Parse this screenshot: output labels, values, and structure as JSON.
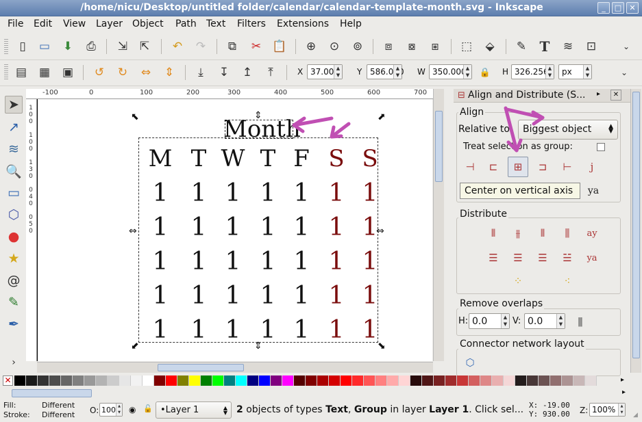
{
  "window": {
    "title": "/home/nicu/Desktop/untitled folder/calendar/calendar-template-month.svg - Inkscape",
    "buttons": [
      "_",
      "□",
      "✕"
    ]
  },
  "menu": [
    "File",
    "Edit",
    "View",
    "Layer",
    "Object",
    "Path",
    "Text",
    "Filters",
    "Extensions",
    "Help"
  ],
  "controls": {
    "x_label": "X",
    "x_value": "37.000",
    "y_label": "Y",
    "y_value": "586.000",
    "w_label": "W",
    "w_value": "350.000",
    "h_label": "H",
    "h_value": "326.256",
    "unit": "px"
  },
  "ruler": {
    "labels": [
      "-100",
      "0",
      "100",
      "200",
      "300",
      "400",
      "500",
      "600",
      "700"
    ],
    "vlabels": [
      "1",
      "0",
      "0",
      "1",
      "0",
      "0",
      "1",
      "3",
      "0",
      "0",
      "4",
      "0",
      "0",
      "5",
      "0",
      "0",
      "6",
      "0",
      "0",
      "7",
      "0",
      "0",
      "8",
      "0",
      "0"
    ]
  },
  "calendar": {
    "title": "Month",
    "weekdays": [
      "M",
      "T",
      "W",
      "T",
      "F",
      "S",
      "S"
    ],
    "cell": "1",
    "rows": 5,
    "weekend_color": "#7a0d0d"
  },
  "dock": {
    "title": "Align and Distribute (S...",
    "align_header": "Align",
    "relative_label": "Relative to:",
    "relative_value": "Biggest object",
    "treat_label": "Treat selection as group:",
    "tooltip": "Center on vertical axis",
    "distribute_header": "Distribute",
    "overlaps_header": "Remove overlaps",
    "h_label": "H:",
    "h_value": "0.0",
    "v_label": "V:",
    "v_value": "0.0",
    "connector_header": "Connector network layout"
  },
  "palette": [
    "#000000",
    "#1a1a1a",
    "#333333",
    "#4d4d4d",
    "#666666",
    "#808080",
    "#999999",
    "#b3b3b3",
    "#cccccc",
    "#e6e6e6",
    "#f2f2f2",
    "#ffffff",
    "#800000",
    "#ff0000",
    "#808000",
    "#ffff00",
    "#008000",
    "#00ff00",
    "#008080",
    "#00ffff",
    "#000080",
    "#0000ff",
    "#800080",
    "#ff00ff",
    "#550000",
    "#800000",
    "#aa0000",
    "#d40000",
    "#ff0000",
    "#ff2a2a",
    "#ff5555",
    "#ff8080",
    "#ffaaaa",
    "#ffd5d5",
    "#280b0b",
    "#501616",
    "#782121",
    "#a02c2c",
    "#c83737",
    "#d35f5f",
    "#de8787",
    "#e9afaf",
    "#f4d7d7",
    "#241c1c",
    "#483737",
    "#6c5353",
    "#916f6f",
    "#ac9393",
    "#c8b7b7",
    "#e3dbdb"
  ],
  "status": {
    "fill_label": "Fill:",
    "fill_value": "Different",
    "stroke_label": "Stroke:",
    "stroke_value": "Different",
    "opacity_label": "O:",
    "opacity_value": "100",
    "layer": "•Layer 1",
    "msg_a": "2",
    "msg_b": " objects of types ",
    "msg_c": "Text",
    "msg_d": ", ",
    "msg_e": "Group",
    "msg_f": " in layer ",
    "msg_g": "Layer 1",
    "msg_h": ". Click sel...",
    "x_label": "X:",
    "x_value": "-19.00",
    "y_label": "Y:",
    "y_value": "930.00",
    "zoom_label": "Z:",
    "zoom_value": "100%"
  }
}
